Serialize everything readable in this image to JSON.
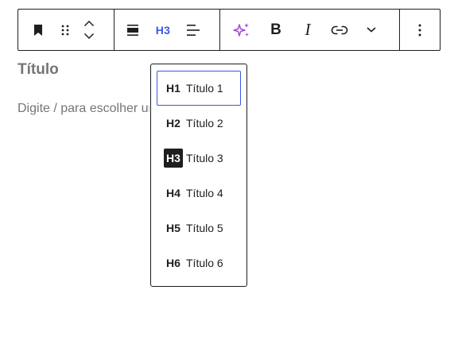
{
  "toolbar": {
    "heading_level": "H3",
    "bold_label": "B",
    "italic_label": "I",
    "accent_color": "#3858e9",
    "ai_color": "#a24bd8"
  },
  "editor": {
    "heading_text": "Título",
    "paragraph_placeholder": "Digite / para escolher um bloco"
  },
  "heading_menu": {
    "items": [
      {
        "level": "H1",
        "label": "Título 1"
      },
      {
        "level": "H2",
        "label": "Título 2"
      },
      {
        "level": "H3",
        "label": "Título 3"
      },
      {
        "level": "H4",
        "label": "Título 4"
      },
      {
        "level": "H5",
        "label": "Título 5"
      },
      {
        "level": "H6",
        "label": "Título 6"
      }
    ],
    "focused_item": "H1",
    "active_item": "H3"
  }
}
